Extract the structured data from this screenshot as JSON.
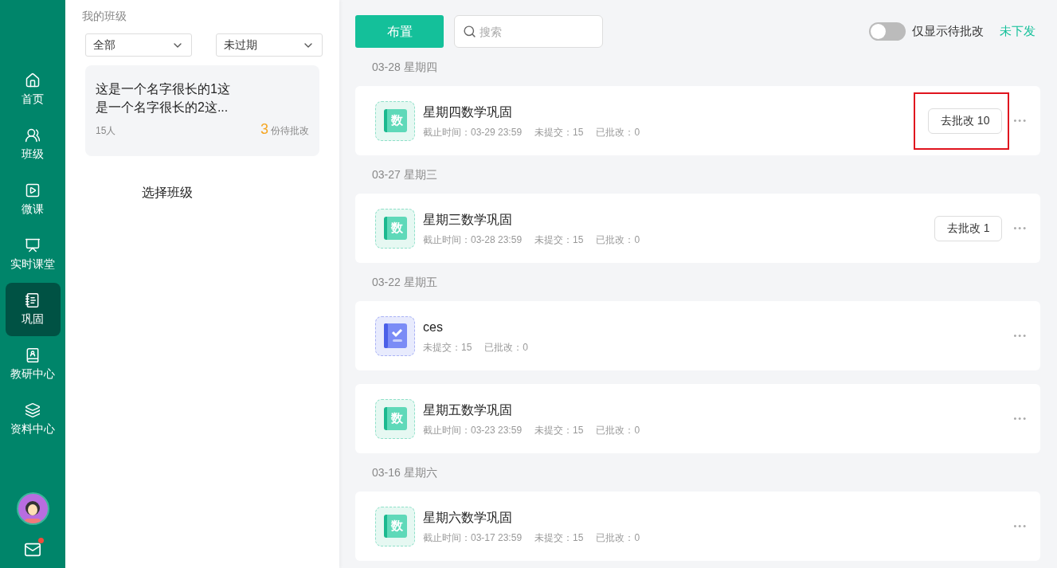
{
  "sidebar": {
    "items": [
      {
        "label": "首页",
        "selected": false
      },
      {
        "label": "班级",
        "selected": false
      },
      {
        "label": "微课",
        "selected": false
      },
      {
        "label": "实时课堂",
        "selected": false
      },
      {
        "label": "巩固",
        "selected": true
      },
      {
        "label": "教研中心",
        "selected": false
      },
      {
        "label": "资料中心",
        "selected": false
      }
    ],
    "mail": {
      "unread": true
    }
  },
  "class_panel": {
    "title": "我的班级",
    "filters": [
      {
        "value": "全部"
      },
      {
        "value": "未过期"
      }
    ],
    "classes": [
      {
        "name": "这是一个名字很长的1这是一个名字很长的2这...",
        "members": "15人",
        "pending_count": "3",
        "pending_label": "份待批改"
      }
    ],
    "prompt": "选择班级"
  },
  "toolbar": {
    "assign_button": "布置",
    "search": {
      "placeholder": "搜索"
    },
    "toggle": {
      "label": "仅显示待批改",
      "on": false
    },
    "link": "未下发"
  },
  "groups": [
    {
      "date": "03-28 星期四",
      "tasks": [
        {
          "kind": "math",
          "icon_text": "数",
          "title": "星期四数学巩固",
          "meta": [
            "截止时间：03-29 23:59",
            "未提交：15",
            "已批改：0"
          ],
          "grade_button": "去批改 10",
          "highlighted": true,
          "more": "•••"
        }
      ]
    },
    {
      "date": "03-27 星期三",
      "tasks": [
        {
          "kind": "math",
          "icon_text": "数",
          "title": "星期三数学巩固",
          "meta": [
            "截止时间：03-28 23:59",
            "未提交：15",
            "已批改：0"
          ],
          "grade_button": "去批改 1",
          "highlighted": false,
          "more": "•••"
        }
      ]
    },
    {
      "date": "03-22 星期五",
      "tasks": [
        {
          "kind": "checklist",
          "title": "ces",
          "meta": [
            "未提交：15",
            "已批改：0"
          ],
          "more": "•••"
        },
        {
          "kind": "math",
          "icon_text": "数",
          "title": "星期五数学巩固",
          "meta": [
            "截止时间：03-23 23:59",
            "未提交：15",
            "已批改：0"
          ],
          "more": "•••"
        }
      ]
    },
    {
      "date": "03-16 星期六",
      "tasks": [
        {
          "kind": "math",
          "icon_text": "数",
          "title": "星期六数学巩固",
          "meta": [
            "截止时间：03-17 23:59",
            "未提交：15",
            "已批改：0"
          ],
          "more": "•••"
        }
      ]
    }
  ]
}
